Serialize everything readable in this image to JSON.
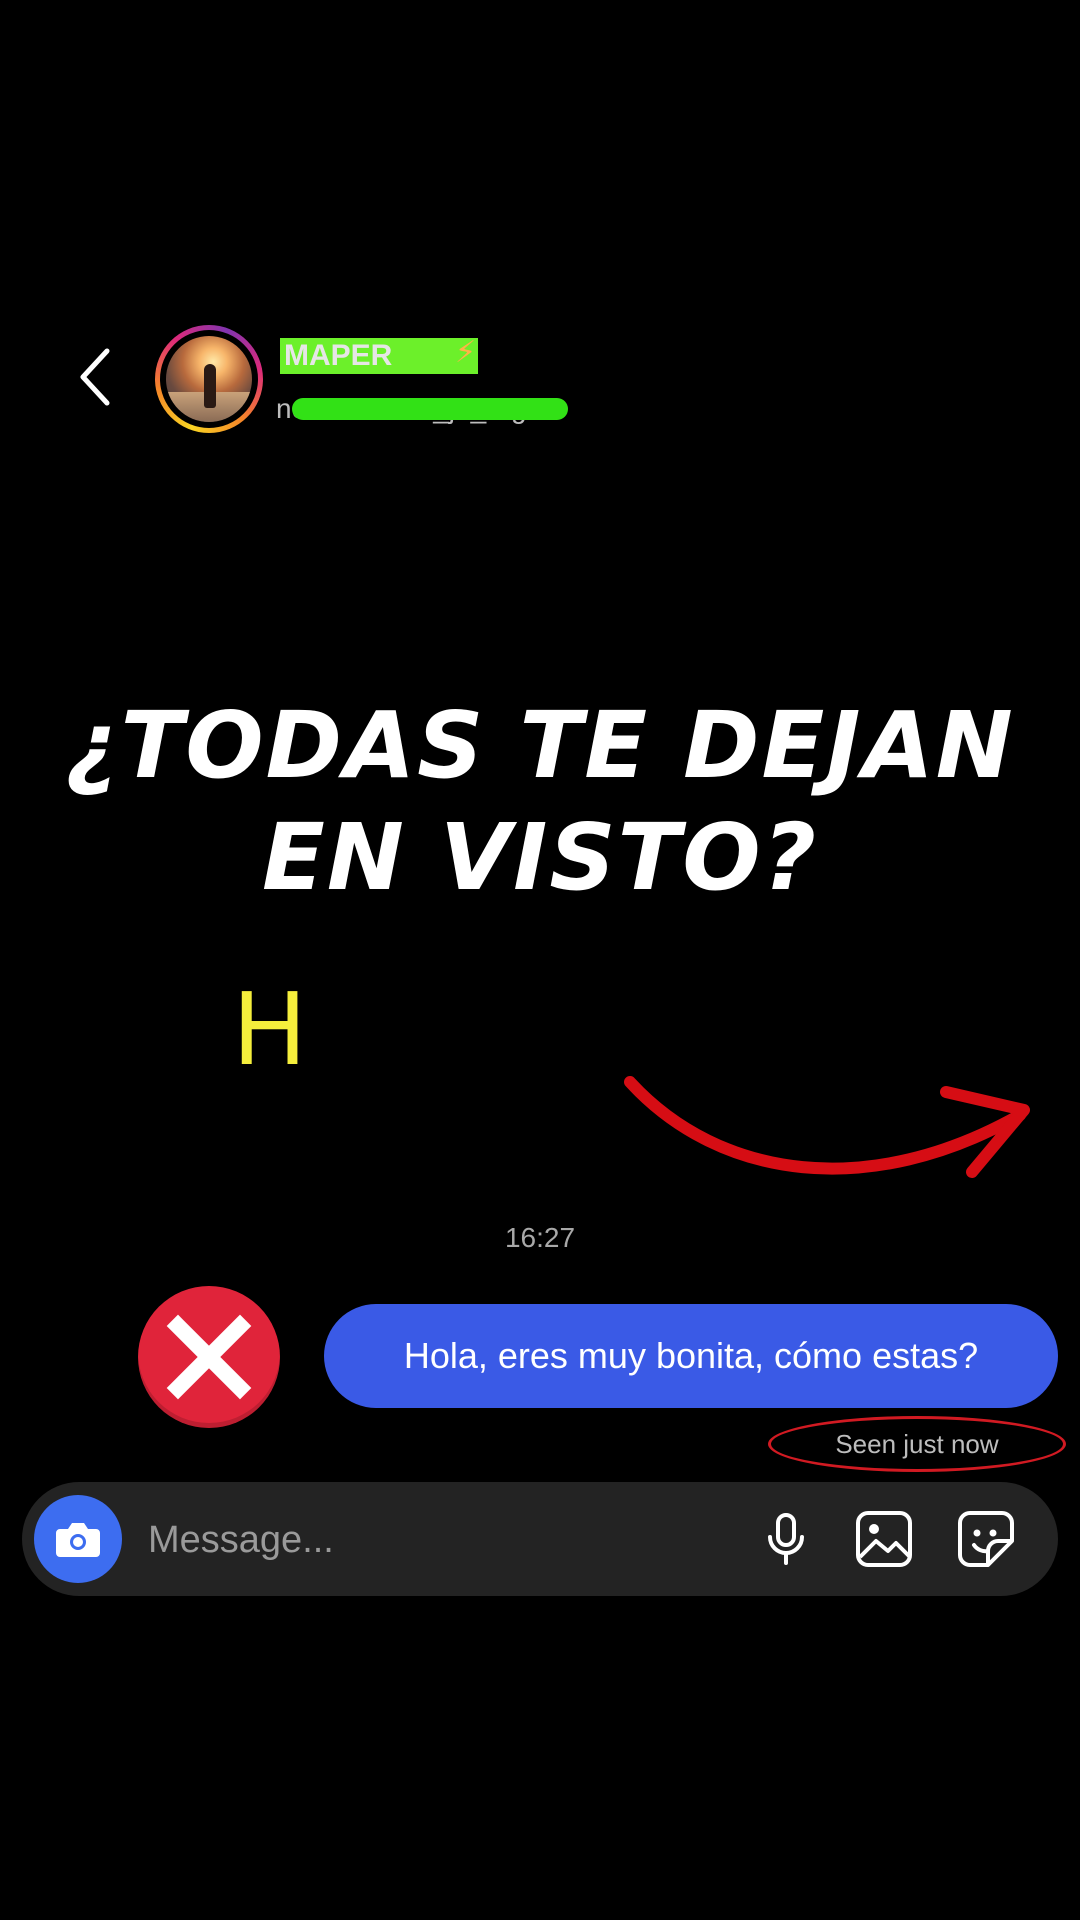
{
  "header": {
    "contact_name": "MAPER",
    "username": "nomeolvides_jh_argui",
    "name_emoji": "⚡"
  },
  "overlay": {
    "headline_line1": "¿TODAS TE DEJAN",
    "headline_line2": "EN VISTO?",
    "letter_mark": "H"
  },
  "chat": {
    "timestamp": "16:27",
    "message": "Hola, eres muy bonita, cómo estas?",
    "seen_status": "Seen just now"
  },
  "composer": {
    "placeholder": "Message..."
  },
  "colors": {
    "bubble": "#3a5ae6",
    "camera": "#3d6df0",
    "x_badge": "#e0243a",
    "arrow": "#d60d14",
    "highlight": "#f5ee3c",
    "redaction": "#32e116"
  },
  "icons": [
    "chevron-left-icon",
    "camera-icon",
    "microphone-icon",
    "image-icon",
    "sticker-icon",
    "x-icon",
    "arrow-icon"
  ]
}
